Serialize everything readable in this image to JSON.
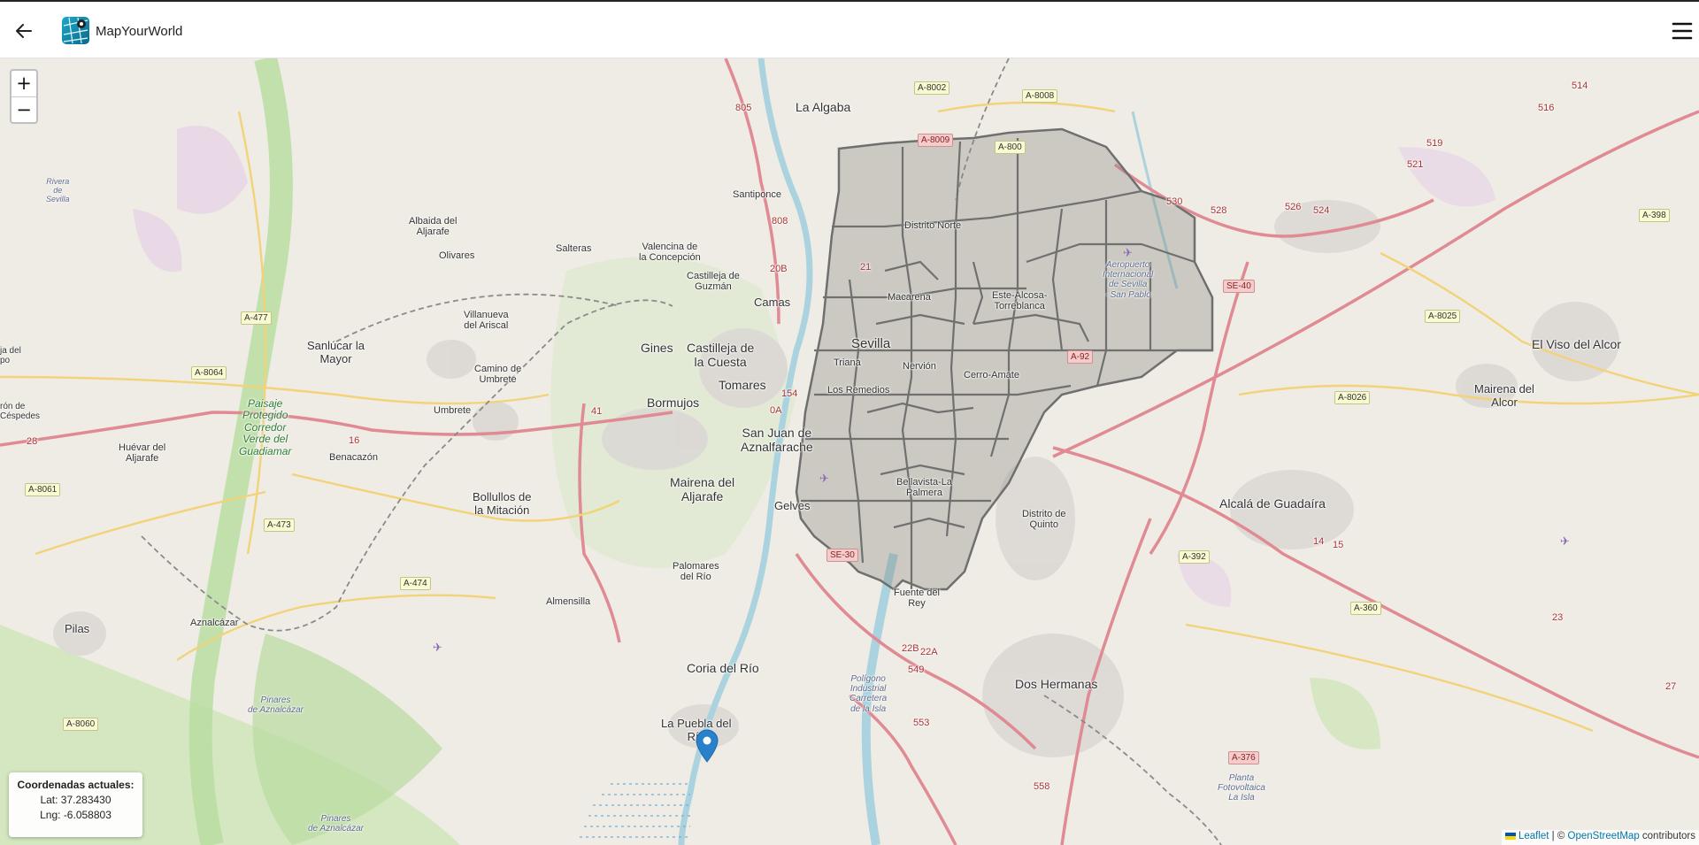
{
  "app": {
    "title": "MapYourWorld"
  },
  "header": {
    "back_icon": "arrow-left-icon",
    "menu_icon": "hamburger-menu-icon"
  },
  "zoom": {
    "in_label": "+",
    "out_label": "−"
  },
  "coords": {
    "title": "Coordenadas actuales:",
    "lat_text": "Lat: 37.283430",
    "lng_text": "Lng: -6.058803",
    "lat": 37.28343,
    "lng": -6.058803
  },
  "attribution": {
    "leaflet": "Leaflet",
    "separator": " | © ",
    "osm": "OpenStreetMap",
    "suffix": " contributors"
  },
  "places": {
    "la_algaba": "La Algaba",
    "santiponce": "Santiponce",
    "albaida": "Albaida del\nAljarafe",
    "olivares": "Olivares",
    "salteras": "Salteras",
    "valencina": "Valencina de\nla Concepción",
    "castilleja_guzman": "Castilleja de\nGuzmán",
    "camas": "Camas",
    "villanueva": "Villanueva\ndel Ariscal",
    "sanlucar": "Sanlúcar la\nMayor",
    "camino": "Camino de\nUmbrete",
    "umbrete": "Umbrete",
    "gines": "Gines",
    "castilleja_cuesta": "Castilleja de\nla Cuesta",
    "tomares": "Tomares",
    "bormujos": "Bormujos",
    "san_juan": "San Juan de\nAznalfarache",
    "mairena_aljarafe": "Mairena del\nAljarafe",
    "gelves": "Gelves",
    "bollullos": "Bollullos de\nla Mitación",
    "palomares": "Palomares\ndel Río",
    "almensilla": "Almensilla",
    "huevar": "Huévar del\nAljarafe",
    "benacazon": "Benacazón",
    "pilas": "Pilas",
    "aznalcazar": "Aznalcázar",
    "coria": "Coria del Río",
    "puebla": "La Puebla del\nRío",
    "sevilla": "Sevilla",
    "triana": "Triana",
    "los_remedios": "Los Remedios",
    "macarena": "Macarena",
    "distrito_norte": "Distrito Norte",
    "este_alcosa": "Este-Alcosa-\nTorreblanca",
    "nervion": "Nervión",
    "cerro_amate": "Cerro-Amate",
    "bellavista": "Bellavista-La\nPalmera",
    "distrito_quinto": "Distrito de\nQuinto",
    "fuente_rey": "Fuente del\nRey",
    "dos_hermanas": "Dos Hermanas",
    "alcala": "Alcalá de Guadaíra",
    "el_viso": "El Viso del Alcor",
    "mairena_alcor": "Mairena del\nAlcor",
    "aeropuerto": "Aeropuerto\nInternacional\nde Sevilla\n- San Pablo",
    "poligono": "Polígono\nIndustrial\nCarretera\nde la Isla",
    "planta": "Planta\nFotovoltaica\nLa Isla",
    "pinares1": "Pinares\nde Aznalcázar",
    "pinares2": "Pinares\nde Aznalcázar",
    "paisaje": "Paisaje\nProtegido\nCorredor\nVerde del\nGuadiamar",
    "rivera": "Rivera\nde\nSevilla",
    "cespedes": "rón de\nCéspedes",
    "ja_del": "ja del\npo"
  },
  "roads": {
    "a8002": "A-8002",
    "a8008": "A-8008",
    "a8009": "A-8009",
    "a8003": "A-800",
    "a477": "A-477",
    "a8064": "A-8064",
    "a8061": "A-8061",
    "a473": "A-473",
    "a474": "A-474",
    "a8060": "A-8060",
    "se40": "SE-40",
    "a92": "A-92",
    "se30": "SE-30",
    "a8025": "A-8025",
    "a8026": "A-8026",
    "a398": "A-398",
    "a392": "A-392",
    "a360": "A-360",
    "a376": "A-376",
    "n805": "805",
    "n808": "808",
    "n20b": "20B",
    "n21": "21",
    "n0a": "0A",
    "n154": "154",
    "n549": "549",
    "n553": "553",
    "n22b": "22B",
    "n22a": "22A",
    "n558": "558",
    "n514": "514",
    "n516": "516",
    "n519": "519",
    "n521": "521",
    "n526": "526",
    "n524": "524",
    "n528": "528",
    "n530": "530",
    "n23": "23",
    "n27": "27",
    "n15": "15",
    "n14": "14",
    "n41": "41",
    "n28": "28",
    "n16": "16"
  }
}
